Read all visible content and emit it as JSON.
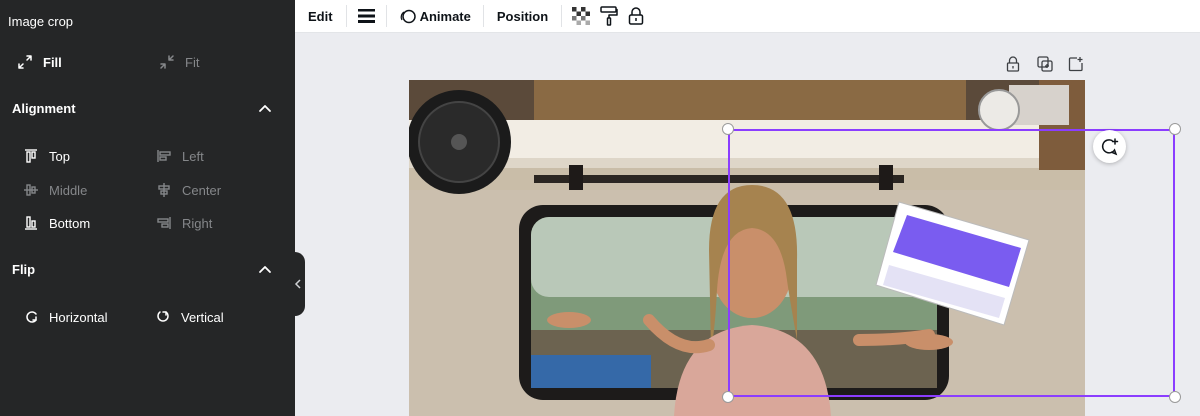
{
  "panel": {
    "title": "Image crop",
    "crop_modes": [
      {
        "label": "Fill",
        "active": true,
        "icon": "expand-arrows-icon"
      },
      {
        "label": "Fit",
        "active": false,
        "icon": "collapse-arrows-icon"
      }
    ],
    "alignment": {
      "title": "Alignment",
      "items": [
        {
          "label": "Top",
          "enabled": true,
          "icon": "align-top-icon"
        },
        {
          "label": "Left",
          "enabled": false,
          "icon": "align-left-icon"
        },
        {
          "label": "Middle",
          "enabled": false,
          "icon": "align-middle-icon"
        },
        {
          "label": "Center",
          "enabled": false,
          "icon": "align-center-icon"
        },
        {
          "label": "Bottom",
          "enabled": true,
          "icon": "align-bottom-icon"
        },
        {
          "label": "Right",
          "enabled": false,
          "icon": "align-right-icon"
        }
      ]
    },
    "flip": {
      "title": "Flip",
      "items": [
        {
          "label": "Horizontal",
          "icon": "flip-horizontal-icon"
        },
        {
          "label": "Vertical",
          "icon": "flip-vertical-icon"
        }
      ]
    }
  },
  "toolbar": {
    "edit_label": "Edit",
    "animate_label": "Animate",
    "position_label": "Position",
    "icons": [
      "border-style-icon",
      "animate-icon",
      "transparency-icon",
      "paint-roller-icon",
      "lock-icon"
    ]
  },
  "canvas": {
    "page_tools": [
      "lock-icon",
      "duplicate-page-icon",
      "add-page-icon"
    ],
    "selection_color": "#8b3dff",
    "comment_icon": "add-comment-icon"
  },
  "colors": {
    "panel_bg": "#252627",
    "canvas_bg": "#ebecf0",
    "accent": "#8b3dff"
  }
}
